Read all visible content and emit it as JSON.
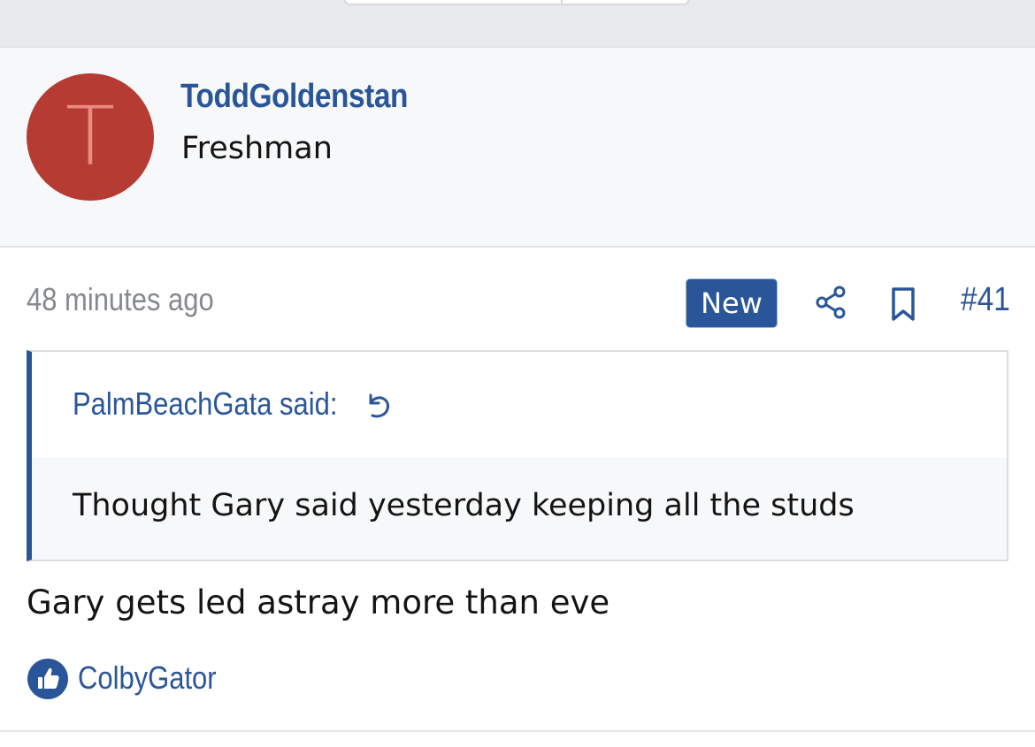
{
  "post": {
    "author": {
      "avatar_letter": "T",
      "avatar_color": "#b53b33",
      "username": "ToddGoldenstan",
      "title": "Freshman"
    },
    "timestamp": "48 minutes ago",
    "badge": "New",
    "actions": {
      "share_icon": "share-icon",
      "bookmark_icon": "bookmark-icon"
    },
    "post_number": "#41",
    "quote": {
      "author_line": "PalmBeachGata said:",
      "reply_icon": "reply-arrow-icon",
      "text": "Thought Gary said yesterday keeping all the studs"
    },
    "body": "Gary gets led astray more than eve",
    "reactions": {
      "icon": "thumbs-up-icon",
      "users": "ColbyGator"
    }
  },
  "colors": {
    "accent": "#2a5699",
    "text": "#141414",
    "muted": "#85888d",
    "header_bg": "#f7f8f9"
  }
}
